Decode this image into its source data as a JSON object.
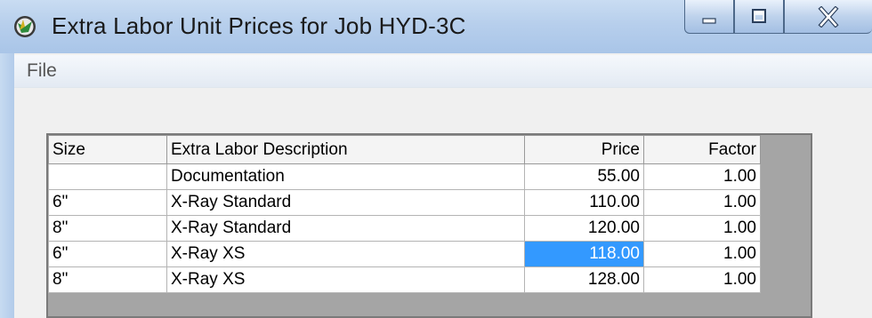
{
  "window": {
    "title": "Extra Labor Unit Prices for Job HYD-3C",
    "icon": "globe-icon"
  },
  "menu": {
    "file_label": "File"
  },
  "grid": {
    "columns": [
      "Size",
      "Extra Labor Description",
      "Price",
      "Factor"
    ],
    "rows": [
      {
        "size": "",
        "description": "Documentation",
        "price": "55.00",
        "factor": "1.00"
      },
      {
        "size": "6\"",
        "description": "X-Ray Standard",
        "price": "110.00",
        "factor": "1.00"
      },
      {
        "size": "8\"",
        "description": "X-Ray Standard",
        "price": "120.00",
        "factor": "1.00"
      },
      {
        "size": "6\"",
        "description": "X-Ray XS",
        "price": "118.00",
        "factor": "1.00",
        "selected_cell": "price"
      },
      {
        "size": "8\"",
        "description": "X-Ray XS",
        "price": "128.00",
        "factor": "1.00"
      }
    ],
    "selection_color": "#3399ff"
  }
}
